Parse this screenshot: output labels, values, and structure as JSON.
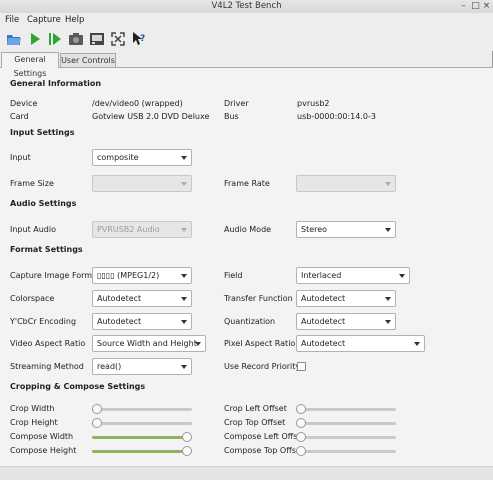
{
  "window": {
    "title": "V4L2 Test Bench"
  },
  "menu": {
    "file": "File",
    "capture": "Capture",
    "help": "Help"
  },
  "toolbar": {
    "icons": [
      "open-icon",
      "start-capture-icon",
      "step-capture-icon",
      "snapshot-icon",
      "show-frames-icon",
      "fullscreen-icon",
      "whats-this-icon"
    ]
  },
  "tabs": {
    "general": "General Settings",
    "user": "User Controls"
  },
  "general": {
    "title": "General Information",
    "device_label": "Device",
    "device_value": "/dev/video0 (wrapped)",
    "driver_label": "Driver",
    "driver_value": "pvrusb2",
    "card_label": "Card",
    "card_value": "Gotview USB 2.0 DVD Deluxe",
    "bus_label": "Bus",
    "bus_value": "usb-0000:00:14.0-3"
  },
  "input": {
    "title": "Input Settings",
    "input_label": "Input",
    "input_value": "composite",
    "frame_size_label": "Frame Size",
    "frame_size_value": "",
    "frame_rate_label": "Frame Rate",
    "frame_rate_value": ""
  },
  "audio": {
    "title": "Audio Settings",
    "input_label": "Input Audio",
    "input_value": "PVRUSB2 Audio",
    "mode_label": "Audio Mode",
    "mode_value": "Stereo"
  },
  "format": {
    "title": "Format Settings",
    "capture_fmt_label": "Capture Image Formats",
    "capture_fmt_value": "▯▯▯▯ (MPEG1/2)",
    "field_label": "Field",
    "field_value": "Interlaced",
    "colorspace_label": "Colorspace",
    "colorspace_value": "Autodetect",
    "transfer_label": "Transfer Function",
    "transfer_value": "Autodetect",
    "ycbcr_label": "Y'CbCr Encoding",
    "ycbcr_value": "Autodetect",
    "quant_label": "Quantization",
    "quant_value": "Autodetect",
    "video_aspect_label": "Video Aspect Ratio",
    "video_aspect_value": "Source Width and Height",
    "pixel_aspect_label": "Pixel Aspect Ratio",
    "pixel_aspect_value": "Autodetect",
    "stream_label": "Streaming Method",
    "stream_value": "read()",
    "record_prio_label": "Use Record Priority",
    "record_prio_checked": false
  },
  "crop": {
    "title": "Cropping & Compose Settings",
    "crop_width_label": "Crop Width",
    "crop_width_level": 0,
    "crop_height_label": "Crop Height",
    "crop_height_level": 0,
    "compose_width_label": "Compose Width",
    "compose_width_level": 1,
    "compose_height_label": "Compose Height",
    "compose_height_level": 1,
    "crop_left_label": "Crop Left Offset",
    "crop_left_level": 0,
    "crop_top_label": "Crop Top Offset",
    "crop_top_level": 0,
    "compose_left_label": "Compose Left Offset",
    "compose_left_level": 0,
    "compose_top_label": "Compose Top Offset",
    "compose_top_level": 0
  }
}
